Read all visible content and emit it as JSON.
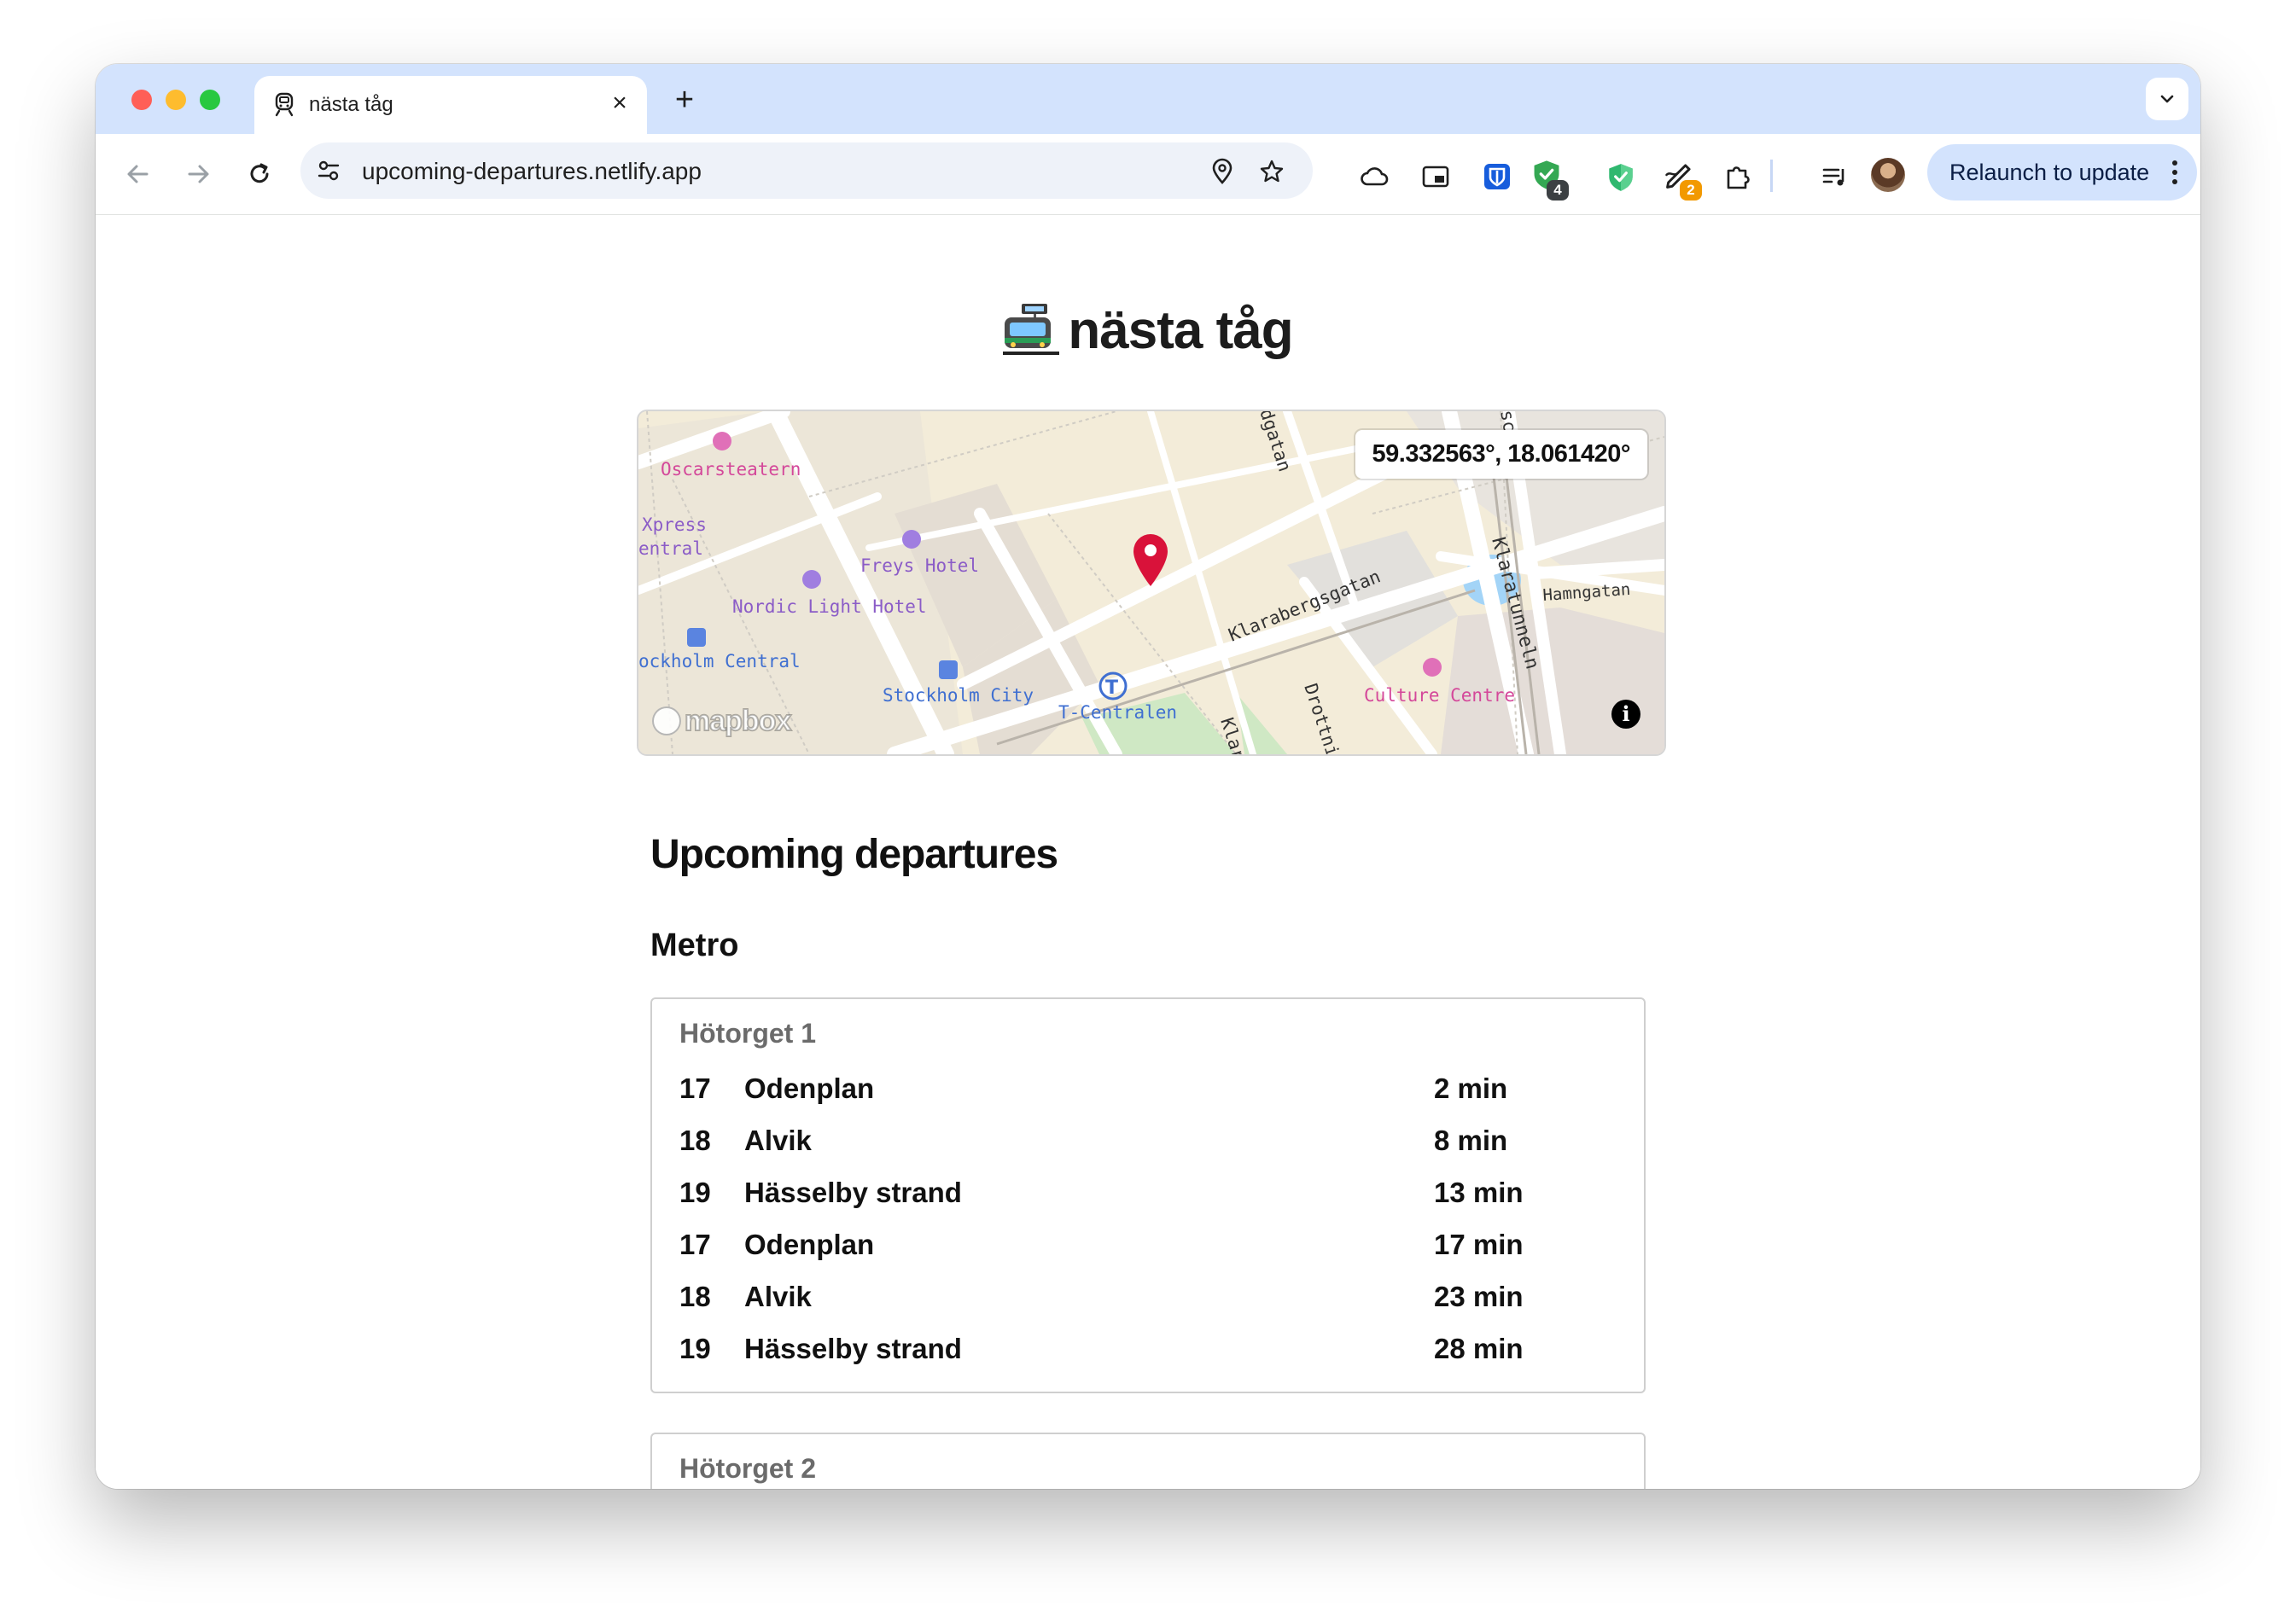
{
  "browser": {
    "tab_title": "nästa tåg",
    "url": "upcoming-departures.netlify.app",
    "extension_badges": {
      "shield": "4",
      "pen": "2"
    },
    "relaunch_label": "Relaunch to update"
  },
  "page": {
    "title": "nästa tåg",
    "map": {
      "coordinates": "59.332563°, 18.061420°",
      "attribution": "mapbox",
      "labels": {
        "oscarsteatern": "Oscarsteatern",
        "xpress": "Xpress",
        "central_partial": "entral",
        "freys_hotel": "Freys Hotel",
        "nordic_light_hotel": "Nordic Light Hotel",
        "stockholm_central": "ockholm Central",
        "stockholm_city": "Stockholm City",
        "t_centralen": "T-Centralen",
        "klarabergsgatan": "Klarabergsgatan",
        "klaratunneln": "Klaratunneln",
        "hamngatan": "Hamngatan",
        "culture_centre": "Culture Centre",
        "drottning": "Drottnin",
        "klar": "Klar",
        "dgatan": "dgatan",
        "sc": "sc"
      }
    },
    "section_heading": "Upcoming departures",
    "group_heading": "Metro",
    "stops": [
      {
        "name": "Hötorget 1",
        "departures": [
          {
            "line": "17",
            "destination": "Odenplan",
            "time": "2 min"
          },
          {
            "line": "18",
            "destination": "Alvik",
            "time": "8 min"
          },
          {
            "line": "19",
            "destination": "Hässelby strand",
            "time": "13 min"
          },
          {
            "line": "17",
            "destination": "Odenplan",
            "time": "17 min"
          },
          {
            "line": "18",
            "destination": "Alvik",
            "time": "23 min"
          },
          {
            "line": "19",
            "destination": "Hässelby strand",
            "time": "28 min"
          }
        ]
      },
      {
        "name": "Hötorget 2",
        "departures": []
      }
    ]
  },
  "colors": {
    "tab_strip": "#d3e3fd",
    "map_pin": "#d9123a",
    "map_poi_purple": "#8b5cc7",
    "map_poi_pink": "#d4489a",
    "map_transit_blue": "#3f6fd1"
  }
}
